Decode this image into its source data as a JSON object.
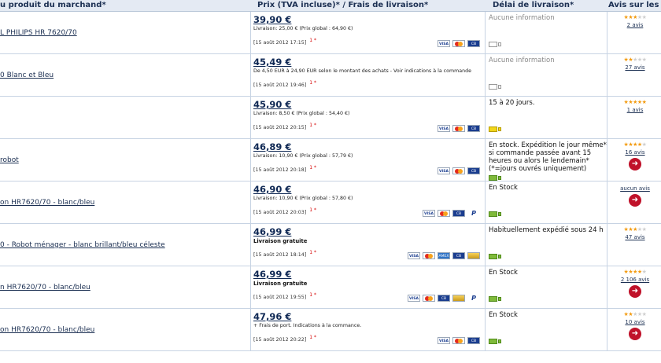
{
  "header": {
    "product": "u produit du marchand*",
    "price": "Prix (TVA incluse)* / Frais de livraison*",
    "delivery": "Délai de livraison*",
    "reviews": "Avis sur les"
  },
  "rows": [
    {
      "product": "L PHILIPS HR 7620/70",
      "price": "39,90 €",
      "shipping": "Livraison: 25,00 € (Prix global : 64,90 €)",
      "free": false,
      "timestamp": "[15 août 2012 17:15]",
      "cards": [
        "VISA",
        "MC",
        "CB"
      ],
      "delivery": "Aucune information",
      "delivery_muted": true,
      "truck": "grey",
      "stars": 3,
      "reviews_link": "2 avis",
      "go": false
    },
    {
      "product": "0 Blanc et Bleu",
      "price": "45,49 €",
      "shipping": "De 4,50 EUR à 24,90 EUR selon le montant des achats - Voir indications à la commande",
      "free": false,
      "timestamp": "[15 août 2012 19:46]",
      "cards": [],
      "delivery": "Aucune information",
      "delivery_muted": true,
      "truck": "grey",
      "stars": 2,
      "reviews_link": "27 avis",
      "go": false
    },
    {
      "product": "",
      "price": "45,90 €",
      "shipping": "Livraison: 8,50 € (Prix global : 54,40 €)",
      "free": false,
      "timestamp": "[15 août 2012 20:15]",
      "cards": [
        "VISA",
        "MC",
        "CB"
      ],
      "delivery": "15 à 20 jours.",
      "delivery_muted": false,
      "truck": "yellow",
      "stars": 5,
      "reviews_link": "1 avis",
      "go": false
    },
    {
      "product": "robot",
      "price": "46,89 €",
      "shipping": "Livraison: 10,90 € (Prix global : 57,79 €)",
      "free": false,
      "timestamp": "[15 août 2012 20:18]",
      "cards": [
        "VISA",
        "MC",
        "CB"
      ],
      "delivery": "En stock. Expédition le jour même* si commande passée avant 15 heures ou alors le lendemain* (*=jours ouvrés uniquement)",
      "delivery_muted": false,
      "truck": "green",
      "stars": 4,
      "reviews_link": "16 avis",
      "go": true
    },
    {
      "product": "on HR7620/70 - blanc/bleu",
      "price": "46,90 €",
      "shipping": "Livraison: 10,90 € (Prix global : 57,80 €)",
      "free": false,
      "timestamp": "[15 août 2012 20:03]",
      "cards": [
        "VISA",
        "MC",
        "CB",
        "PP"
      ],
      "delivery": "En Stock",
      "delivery_muted": false,
      "truck": "green",
      "stars": 0,
      "reviews_link": "aucun avis",
      "go": true
    },
    {
      "product": "0 - Robot ménager - blanc brillant/bleu céleste",
      "price": "46,99 €",
      "shipping": "Livraison gratuite",
      "free": true,
      "timestamp": "[15 août 2012 18:14]",
      "cards": [
        "VISA",
        "MC",
        "AMEX",
        "CB",
        "GOLD"
      ],
      "delivery": "Habituellement expédié sous 24 h",
      "delivery_muted": false,
      "truck": "green",
      "stars": 3,
      "reviews_link": "47 avis",
      "go": false
    },
    {
      "product": "n HR7620/70 - blanc/bleu",
      "price": "46,99 €",
      "shipping": "Livraison gratuite",
      "free": true,
      "timestamp": "[15 août 2012 19:55]",
      "cards": [
        "VISA",
        "MC",
        "CB",
        "GOLD",
        "PP"
      ],
      "delivery": "En Stock",
      "delivery_muted": false,
      "truck": "green",
      "stars": 4,
      "reviews_link": "2 106 avis",
      "go": true
    },
    {
      "product": "on HR7620/70 - blanc/bleu",
      "price": "47,96 €",
      "shipping": "+ Frais de port. Indications à la commance.",
      "free": false,
      "timestamp": "[15 août 2012 20:22]",
      "cards": [
        "VISA",
        "MC",
        "CB"
      ],
      "delivery": "En Stock",
      "delivery_muted": false,
      "truck": "green",
      "stars": 2,
      "reviews_link": "10 avis",
      "go": true
    }
  ],
  "labels": {
    "star_marker": "1 *",
    "go_arrow": "➜",
    "card_visa": "VISA",
    "card_cb": "CB",
    "card_amex": "AMEX",
    "card_pp": "P"
  },
  "colors": {
    "header_bg": "#e4eaf3",
    "price": "#0f2854",
    "star_on": "#f39c12",
    "go_button": "#c0122a"
  }
}
